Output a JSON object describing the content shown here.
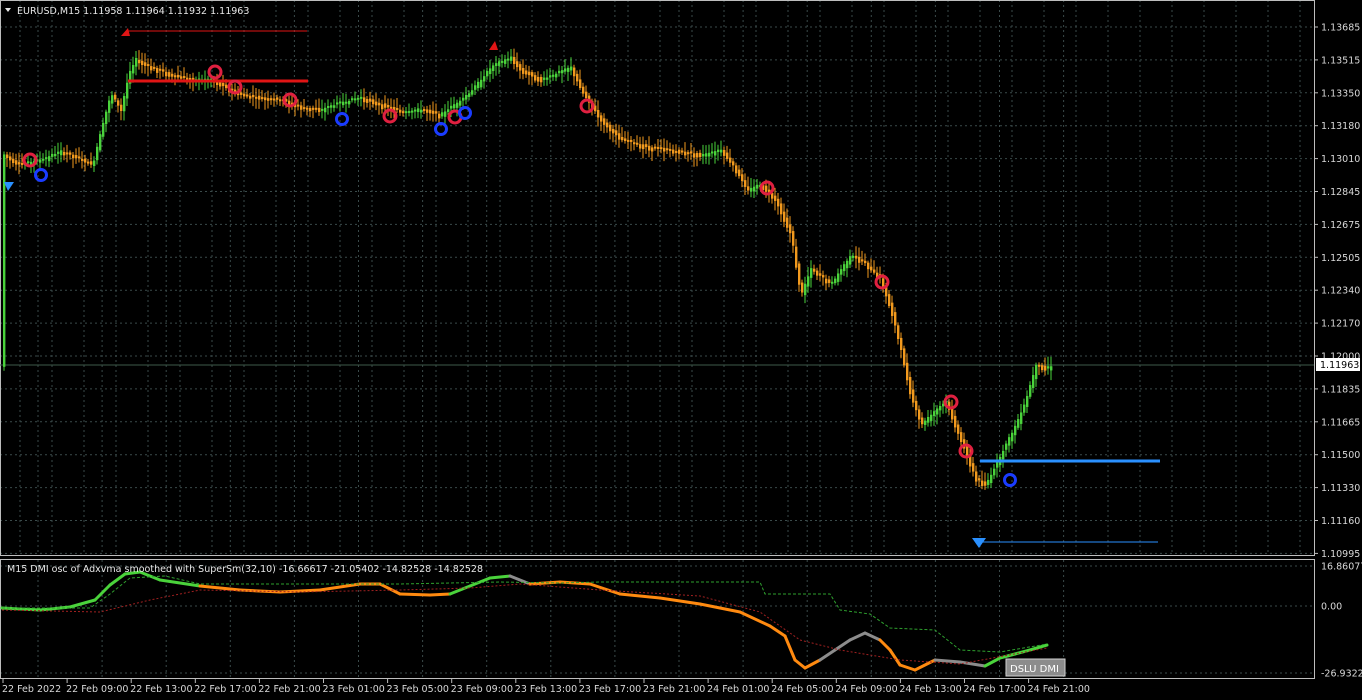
{
  "window": {
    "symbol_title": "EURUSD,M15  1.11958 1.11964 1.11932 1.11963",
    "current_price": "1.11963"
  },
  "price_panel": {
    "y_ticks": [
      "1.13685",
      "1.13515",
      "1.13350",
      "1.13180",
      "1.13010",
      "1.12845",
      "1.12675",
      "1.12505",
      "1.12340",
      "1.12170",
      "1.12000",
      "1.11835",
      "1.11665",
      "1.11500",
      "1.11330",
      "1.11160",
      "1.10995"
    ]
  },
  "indicator_panel": {
    "title": "M15 DMI osc of Adxvma smoothed with SuperSm(32,10) -16.66617 -21.05402 -14.82528 -14.82528",
    "y_ticks": [
      "16.86077",
      "0.00",
      "-26.93226"
    ],
    "label_box": "DSLU DMI"
  },
  "x_axis": {
    "labels": [
      "22 Feb 2022",
      "22 Feb 09:00",
      "22 Feb 13:00",
      "22 Feb 17:00",
      "22 Feb 21:00",
      "23 Feb 01:00",
      "23 Feb 05:00",
      "23 Feb 09:00",
      "23 Feb 13:00",
      "23 Feb 17:00",
      "23 Feb 21:00",
      "24 Feb 01:00",
      "24 Feb 05:00",
      "24 Feb 09:00",
      "24 Feb 13:00",
      "24 Feb 17:00",
      "24 Feb 21:00"
    ]
  },
  "chart_data": {
    "type": "line",
    "title": "EURUSD,M15",
    "series": [
      {
        "name": "EURUSD close",
        "x": [
          "22 Feb 2022",
          "22 Feb 09:00",
          "22 Feb 13:00",
          "22 Feb 17:00",
          "22 Feb 21:00",
          "23 Feb 01:00",
          "23 Feb 05:00",
          "23 Feb 09:00",
          "23 Feb 13:00",
          "23 Feb 17:00",
          "23 Feb 21:00",
          "24 Feb 01:00",
          "24 Feb 05:00",
          "24 Feb 09:00",
          "24 Feb 13:00",
          "24 Feb 17:00",
          "24 Feb 21:00"
        ],
        "values": [
          1.1297,
          1.1303,
          1.1353,
          1.134,
          1.1333,
          1.1332,
          1.1334,
          1.1336,
          1.135,
          1.1318,
          1.1308,
          1.1303,
          1.1223,
          1.1244,
          1.1172,
          1.1145,
          1.1196
        ]
      }
    ],
    "ylim": [
      1.10995,
      1.13685
    ]
  },
  "colors": {
    "bull": "#4ad33b",
    "bear": "#f29a1e",
    "resistance": "#e01515",
    "support": "#2a90ff",
    "osc_up": "#4ad33b",
    "osc_down": "#ff8a10",
    "osc_flat": "#8c8c8c"
  }
}
